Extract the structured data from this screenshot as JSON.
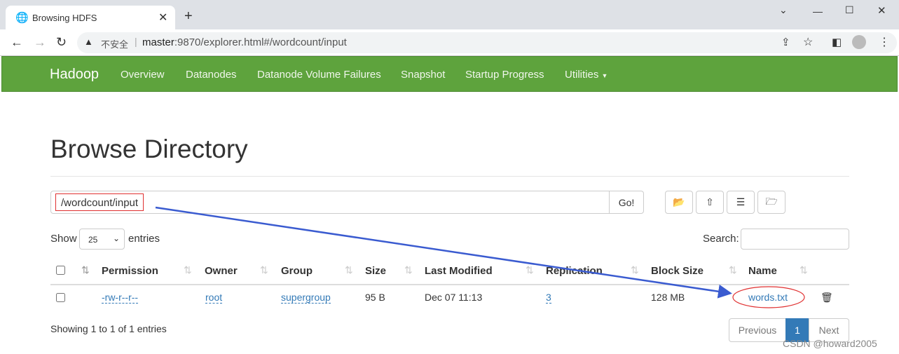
{
  "browser": {
    "tab_title": "Browsing HDFS",
    "security": "不安全",
    "url_host": "master",
    "url_rest": ":9870/explorer.html#/wordcount/input"
  },
  "nav": {
    "brand": "Hadoop",
    "items": [
      "Overview",
      "Datanodes",
      "Datanode Volume Failures",
      "Snapshot",
      "Startup Progress",
      "Utilities"
    ]
  },
  "page": {
    "title": "Browse Directory",
    "path": "/wordcount/input",
    "go": "Go!",
    "show": "Show",
    "entries_value": "25",
    "entries": "entries",
    "search_label": "Search:",
    "search_value": ""
  },
  "table": {
    "columns": [
      "Permission",
      "Owner",
      "Group",
      "Size",
      "Last Modified",
      "Replication",
      "Block Size",
      "Name"
    ],
    "rows": [
      {
        "permission": "-rw-r--r--",
        "owner": "root",
        "group": "supergroup",
        "size": "95 B",
        "modified": "Dec 07 11:13",
        "replication": "3",
        "block_size": "128 MB",
        "name": "words.txt"
      }
    ]
  },
  "footer": {
    "info": "Showing 1 to 1 of 1 entries",
    "previous": "Previous",
    "page": "1",
    "next": "Next"
  },
  "watermark": "CSDN @howard2005",
  "colors": {
    "navbar": "#5ea33d",
    "link": "#337ab7",
    "active_page": "#337ab7",
    "annotation_red": "#e03030",
    "annotation_arrow": "#3a5bd0"
  }
}
